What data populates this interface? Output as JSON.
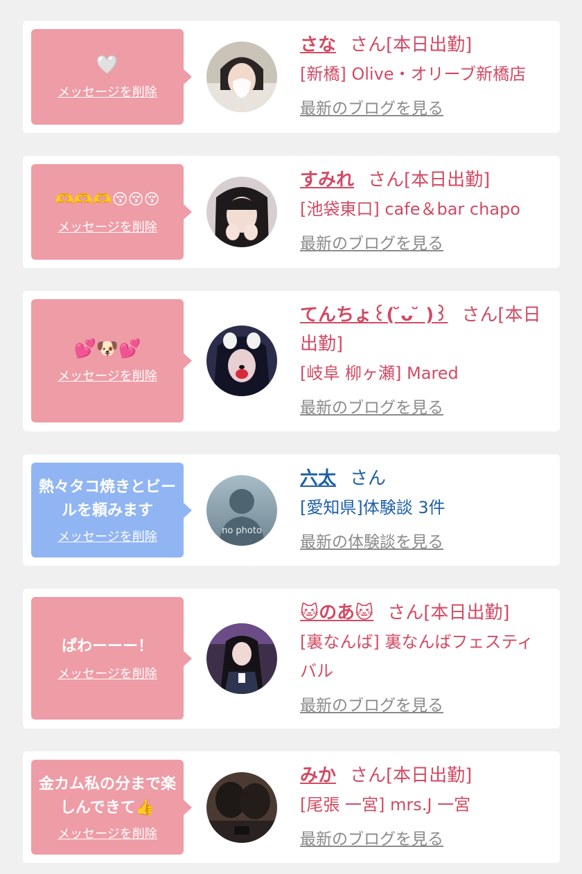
{
  "colors": {
    "pink_bubble": "#ee9ca6",
    "blue_bubble": "#91b5f2",
    "pink_text": "#d24a63",
    "blue_text": "#1d5fa8",
    "link_gray": "#8a8a8a"
  },
  "delete_label": "メッセージを削除",
  "cards": [
    {
      "message": "🤍",
      "name": "さな",
      "suffix": "さん[本日出勤]",
      "shop": "[新橋] Olive・オリーブ新橋店",
      "link": "最新のブログを見る"
    },
    {
      "message": "🫶🫶🫶😚😚😚",
      "name": "すみれ",
      "suffix": "さん[本日出勤]",
      "shop": "[池袋東口] cafe＆bar chapo",
      "link": "最新のブログを見る"
    },
    {
      "message": "💕🐶💕",
      "name": "てんちょ꒰( ̆ᴗ ̆ )꒱",
      "suffix": "さん[本日出勤]",
      "shop": "[岐阜 柳ヶ瀬] Mared",
      "link": "最新のブログを見る"
    },
    {
      "message": "熱々タコ焼きとビールを頼みます",
      "name": "六太",
      "suffix": "さん",
      "shop": "[愛知県]体験談 3件",
      "link": "最新の体験談を見る",
      "avatar_text": "no photo"
    },
    {
      "message": "ぱわーーー！",
      "name": "🐱のあ🐱",
      "suffix": "さん[本日出勤]",
      "shop": "[裏なんば] 裏なんばフェスティバル",
      "link": "最新のブログを見る"
    },
    {
      "message": "金カム私の分まで楽しんできて👍",
      "name": "みか",
      "suffix": "さん[本日出勤]",
      "shop": "[尾張 一宮] mrs.J 一宮",
      "link": "最新のブログを見る"
    }
  ]
}
